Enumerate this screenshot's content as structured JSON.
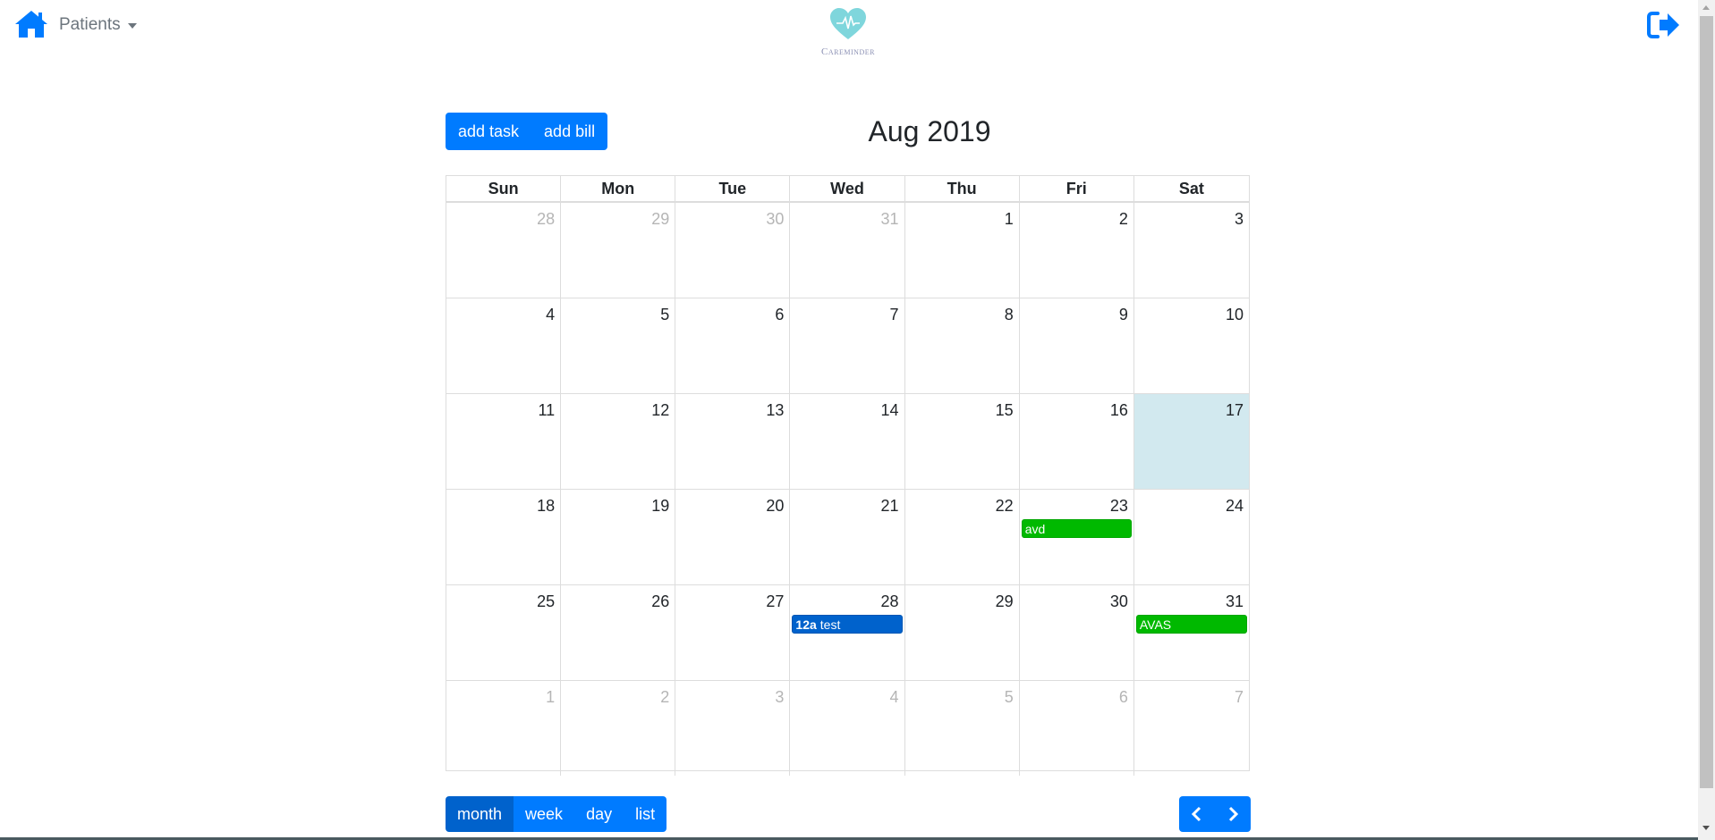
{
  "navbar": {
    "home_icon": "home-icon",
    "patients_label": "Patients",
    "brand_name": "Careminder",
    "logo_icon": "heart-pulse-icon",
    "logout_icon": "sign-out-icon",
    "accent_color": "#007bff"
  },
  "toolbar": {
    "add_task_label": "add task",
    "add_bill_label": "add bill",
    "title": "Aug 2019"
  },
  "calendar": {
    "day_headers": [
      "Sun",
      "Mon",
      "Tue",
      "Wed",
      "Thu",
      "Fri",
      "Sat"
    ],
    "today_color": "#d2e9ef",
    "weeks": [
      [
        {
          "day": "28",
          "other": true
        },
        {
          "day": "29",
          "other": true
        },
        {
          "day": "30",
          "other": true
        },
        {
          "day": "31",
          "other": true
        },
        {
          "day": "1"
        },
        {
          "day": "2"
        },
        {
          "day": "3"
        }
      ],
      [
        {
          "day": "4"
        },
        {
          "day": "5"
        },
        {
          "day": "6"
        },
        {
          "day": "7"
        },
        {
          "day": "8"
        },
        {
          "day": "9"
        },
        {
          "day": "10"
        }
      ],
      [
        {
          "day": "11"
        },
        {
          "day": "12"
        },
        {
          "day": "13"
        },
        {
          "day": "14"
        },
        {
          "day": "15"
        },
        {
          "day": "16"
        },
        {
          "day": "17",
          "today": true
        }
      ],
      [
        {
          "day": "18"
        },
        {
          "day": "19"
        },
        {
          "day": "20"
        },
        {
          "day": "21"
        },
        {
          "day": "22"
        },
        {
          "day": "23",
          "event": {
            "title": "avd",
            "color": "green"
          }
        },
        {
          "day": "24"
        }
      ],
      [
        {
          "day": "25"
        },
        {
          "day": "26"
        },
        {
          "day": "27"
        },
        {
          "day": "28",
          "event": {
            "time": "12a",
            "title": "test",
            "color": "blue"
          }
        },
        {
          "day": "29"
        },
        {
          "day": "30"
        },
        {
          "day": "31",
          "event": {
            "title": "AVAS",
            "color": "green"
          }
        }
      ],
      [
        {
          "day": "1",
          "other": true
        },
        {
          "day": "2",
          "other": true
        },
        {
          "day": "3",
          "other": true
        },
        {
          "day": "4",
          "other": true
        },
        {
          "day": "5",
          "other": true
        },
        {
          "day": "6",
          "other": true
        },
        {
          "day": "7",
          "other": true
        }
      ]
    ]
  },
  "views": {
    "month_label": "month",
    "week_label": "week",
    "day_label": "day",
    "list_label": "list",
    "active": "month"
  },
  "navigation": {
    "prev_icon": "chevron-left-icon",
    "next_icon": "chevron-right-icon"
  }
}
